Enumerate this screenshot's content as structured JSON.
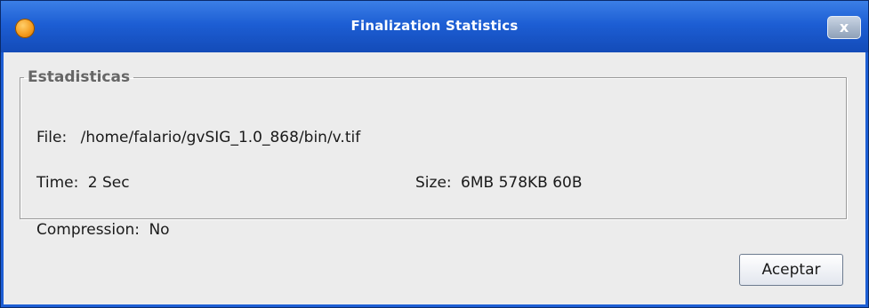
{
  "window": {
    "title": "Finalization Statistics",
    "close_glyph": "x",
    "icons": {
      "app": "app-logo-icon",
      "close": "close-icon"
    }
  },
  "group": {
    "legend": "Estadisticas"
  },
  "stats": {
    "file_label": "File:",
    "file_value": "/home/falario/gvSIG_1.0_868/bin/v.tif",
    "time_label": "Time:",
    "time_value": "2 Sec",
    "size_label": "Size:",
    "size_value": "6MB 578KB 60B",
    "compression_label": "Compression:",
    "compression_value": "No"
  },
  "buttons": {
    "accept_label": "Aceptar"
  },
  "colors": {
    "titlebar": "#1d5ed4",
    "panel_bg": "#ececec",
    "legend_text": "#666666"
  }
}
